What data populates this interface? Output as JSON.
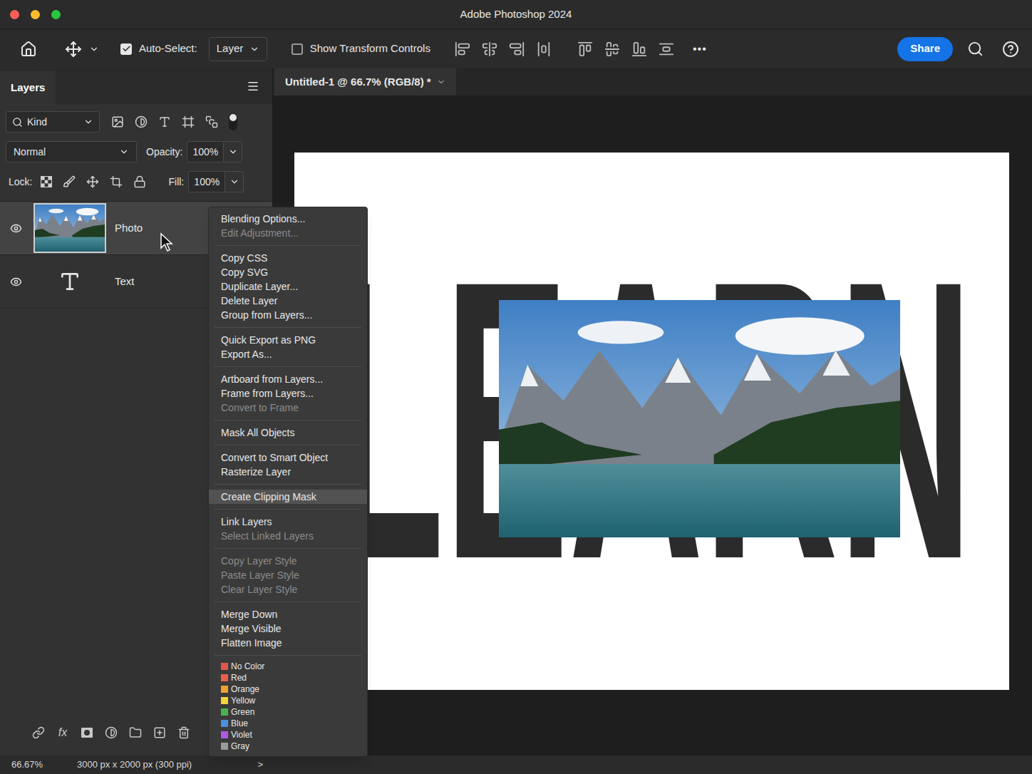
{
  "window": {
    "title": "Adobe Photoshop 2024"
  },
  "options_bar": {
    "auto_select": {
      "label": "Auto-Select:",
      "checked": true
    },
    "target": "Layer",
    "show_transform_controls": {
      "label": "Show Transform Controls",
      "checked": false
    },
    "more": "•••",
    "share": "Share"
  },
  "layers_panel": {
    "tabs": [
      {
        "label": "Layers",
        "selected": true
      }
    ],
    "filter": "Kind",
    "blend_mode": "Normal",
    "opacity": {
      "label": "Opacity:",
      "value": "100%"
    },
    "lock": {
      "label": "Lock:"
    },
    "fill": {
      "label": "Fill:",
      "value": "100%"
    },
    "layers": [
      {
        "name": "Photo",
        "kind": "image",
        "visible": true,
        "selected": true
      },
      {
        "name": "Text",
        "kind": "text",
        "visible": true,
        "selected": false
      }
    ],
    "toolbar": {
      "fx": "fx"
    }
  },
  "document": {
    "tab": "Untitled-1 @ 66.7% (RGB/8) *",
    "canvas_text": "LEARN"
  },
  "context_menu": {
    "groups": [
      [
        {
          "label": "Blending Options...",
          "disabled": false,
          "selected": false
        },
        {
          "label": "Edit Adjustment...",
          "disabled": true,
          "selected": false
        }
      ],
      [
        {
          "label": "Copy CSS",
          "disabled": false,
          "selected": false
        },
        {
          "label": "Copy SVG",
          "disabled": false,
          "selected": false
        },
        {
          "label": "Duplicate Layer...",
          "disabled": false,
          "selected": false
        },
        {
          "label": "Delete Layer",
          "disabled": false,
          "selected": false
        },
        {
          "label": "Group from Layers...",
          "disabled": false,
          "selected": false
        }
      ],
      [
        {
          "label": "Quick Export as PNG",
          "disabled": false,
          "selected": false
        },
        {
          "label": "Export As...",
          "disabled": false,
          "selected": false
        }
      ],
      [
        {
          "label": "Artboard from Layers...",
          "disabled": false,
          "selected": false
        },
        {
          "label": "Frame from Layers...",
          "disabled": false,
          "selected": false
        },
        {
          "label": "Convert to Frame",
          "disabled": true,
          "selected": false
        }
      ],
      [
        {
          "label": "Mask All Objects",
          "disabled": false,
          "selected": false
        }
      ],
      [
        {
          "label": "Convert to Smart Object",
          "disabled": false,
          "selected": false
        },
        {
          "label": "Rasterize Layer",
          "disabled": false,
          "selected": false
        }
      ],
      [
        {
          "label": "Create Clipping Mask",
          "disabled": false,
          "selected": true
        }
      ],
      [
        {
          "label": "Link Layers",
          "disabled": false,
          "selected": false
        },
        {
          "label": "Select Linked Layers",
          "disabled": true,
          "selected": false
        }
      ],
      [
        {
          "label": "Copy Layer Style",
          "disabled": true,
          "selected": false
        },
        {
          "label": "Paste Layer Style",
          "disabled": true,
          "selected": false
        },
        {
          "label": "Clear Layer Style",
          "disabled": true,
          "selected": false
        }
      ],
      [
        {
          "label": "Merge Down",
          "disabled": false,
          "selected": false
        },
        {
          "label": "Merge Visible",
          "disabled": false,
          "selected": false
        },
        {
          "label": "Flatten Image",
          "disabled": false,
          "selected": false
        }
      ]
    ],
    "colors": [
      {
        "label": "No Color",
        "color": "#e0574c"
      },
      {
        "label": "Red",
        "color": "#e8604c"
      },
      {
        "label": "Orange",
        "color": "#f0a030"
      },
      {
        "label": "Yellow",
        "color": "#f2d43c"
      },
      {
        "label": "Green",
        "color": "#48b34e"
      },
      {
        "label": "Blue",
        "color": "#4a8fe0"
      },
      {
        "label": "Violet",
        "color": "#b05ae0"
      },
      {
        "label": "Gray",
        "color": "#9a9a9a"
      }
    ]
  },
  "status_bar": {
    "zoom": "66.67%",
    "size": "3000 px x 2000 px (300 ppi)",
    "more": ">"
  }
}
